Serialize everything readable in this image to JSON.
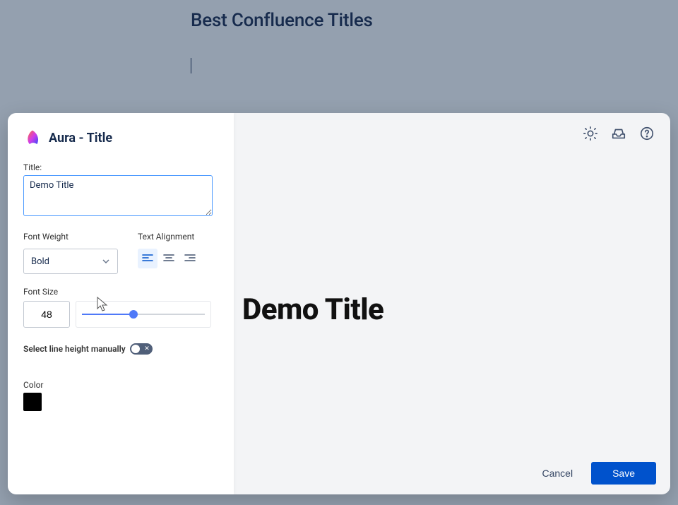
{
  "page": {
    "title": "Best Confluence Titles"
  },
  "modal": {
    "header": "Aura - Title",
    "labels": {
      "title": "Title:",
      "font_weight": "Font Weight",
      "text_alignment": "Text Alignment",
      "font_size": "Font Size",
      "line_height_toggle": "Select line height manually",
      "color": "Color"
    },
    "fields": {
      "title_value": "Demo Title",
      "font_weight_value": "Bold",
      "font_size_value": "48",
      "alignment": "left",
      "line_height_manual": false,
      "color_value": "#000000"
    },
    "footer": {
      "cancel": "Cancel",
      "save": "Save"
    }
  },
  "preview": {
    "title_text": "Demo Title"
  }
}
